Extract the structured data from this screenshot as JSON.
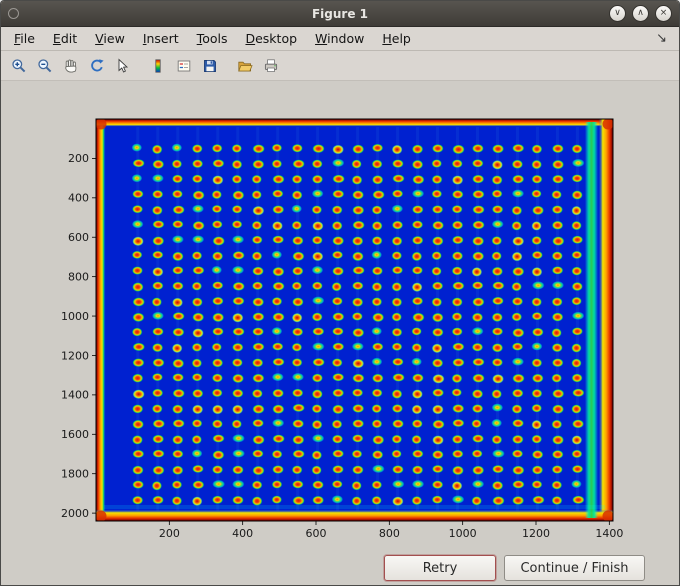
{
  "window": {
    "title": "Figure 1",
    "controls": {
      "minimize": "∨",
      "maximize": "∧",
      "close": "×"
    }
  },
  "menu": {
    "items": [
      "File",
      "Edit",
      "View",
      "Insert",
      "Tools",
      "Desktop",
      "Window",
      "Help"
    ],
    "dock_glyph": "↘"
  },
  "toolbar": {
    "icons": [
      "zoom-in",
      "zoom-out",
      "pan",
      "rotate-3d",
      "data-cursor",
      "colorbar",
      "legend",
      "save",
      "open",
      "print"
    ]
  },
  "plot": {
    "type": "heatmap-image",
    "colormap": "jet",
    "x_ticks": [
      200,
      400,
      600,
      800,
      1000,
      1200,
      1400
    ],
    "y_ticks": [
      200,
      400,
      600,
      800,
      1000,
      1200,
      1400,
      1600,
      1800,
      2000
    ],
    "x_range": [
      0,
      1410
    ],
    "y_range": [
      0,
      2040
    ],
    "background_color": "#0021d0",
    "grid": {
      "cols": 23,
      "rows": 24,
      "x_start": 114,
      "x_step": 54.5,
      "y_start": 150,
      "y_step": 77.6
    }
  },
  "buttons": {
    "retry": "Retry",
    "continue_finish": "Continue / Finish"
  }
}
